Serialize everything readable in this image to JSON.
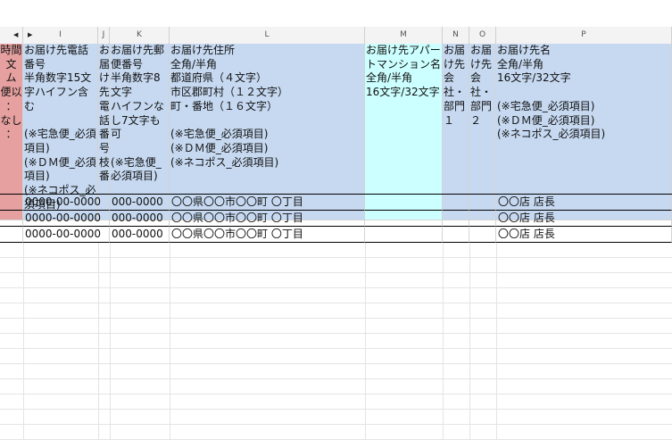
{
  "columns": [
    {
      "id": "H",
      "label": "",
      "left": 0
    },
    {
      "id": "I",
      "label": "I"
    },
    {
      "id": "J",
      "label": "J"
    },
    {
      "id": "K",
      "label": "K"
    },
    {
      "id": "L",
      "label": "L"
    },
    {
      "id": "M",
      "label": "M"
    },
    {
      "id": "N",
      "label": "N"
    },
    {
      "id": "O",
      "label": "O"
    },
    {
      "id": "P",
      "label": "P"
    }
  ],
  "header": {
    "h": "時間\n文\nム\n便以\n：\nなし\n：",
    "i": "お届け先電話番号\n半角数字15文字ハイフン含む\n\n(※宅急便_必須項目)\n(※ＤＭ便_必須項目)\n(※ネコポス_必須項目)",
    "j": "お届け先電話番号枝番",
    "k": "お届け先郵便番号\n半角数字8文字\nハイフンなし7文字も可\n\n(※宅急便_必須項目)",
    "l": "お届け先住所\n全角/半角\n都道府県（４文字）\n市区郡町村（１２文字）\n町・番地（１６文字）\n\n(※宅急便_必須項目)\n(※ＤＭ便_必須項目)\n(※ネコポス_必須項目)",
    "m": "お届け先アパートマンション名\n全角/半角\n16文字/32文字",
    "n": "お届け先会社・部門１",
    "o": "お届け先会社・部門２",
    "p": "お届け先名\n全角/半角\n16文字/32文字\n\n(※宅急便_必須項目)\n(※ＤＭ便_必須項目)\n(※ネコポス_必須項目)"
  },
  "rows": [
    {
      "phone": "0000-00-0000",
      "zip": "000-0000",
      "address": "〇〇県〇〇市〇〇町 〇丁目",
      "name": "〇〇店 店長"
    },
    {
      "phone": "0000-00-0000",
      "zip": "000-0000",
      "address": "〇〇県〇〇市〇〇町 〇丁目",
      "name": "〇〇店 店長"
    },
    {
      "phone": "0000-00-0000",
      "zip": "000-0000",
      "address": "〇〇県〇〇市〇〇町 〇丁目",
      "name": "〇〇店 店長"
    }
  ],
  "colors": {
    "header_blue": "#c6d9f1",
    "header_cyan": "#ccffff",
    "header_red": "#e6a0a0"
  }
}
